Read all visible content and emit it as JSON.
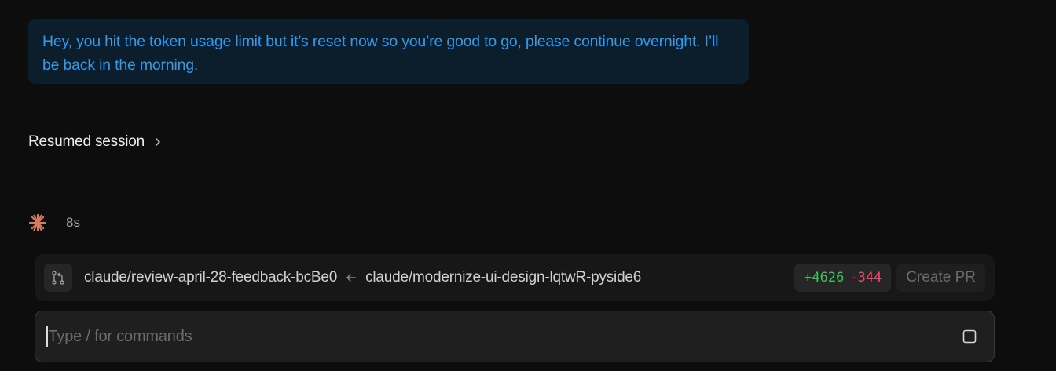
{
  "conversation": {
    "user_message": "Hey, you hit the token usage limit but it’s reset now so you’re good to go, please continue overnight. I’ll be back in the morning.",
    "resumed_label": "Resumed session",
    "elapsed": "8s"
  },
  "branch_bar": {
    "icon": "git-branch-icon",
    "base_branch": "claude/review-april-28-feedback-bcBe0",
    "head_branch": "claude/modernize-ui-design-lqtwR-pyside6",
    "additions": "+4626",
    "deletions": "-344",
    "create_pr_label": "Create PR"
  },
  "composer": {
    "placeholder": "Type / for commands",
    "stop_icon": "stop-square-icon"
  },
  "colors": {
    "background": "#0d0d0d",
    "user_bubble": "#0c1e2c",
    "user_text": "#2e9bf0",
    "spark": "#d9785a",
    "additions": "#34c759",
    "deletions": "#ff4066"
  }
}
